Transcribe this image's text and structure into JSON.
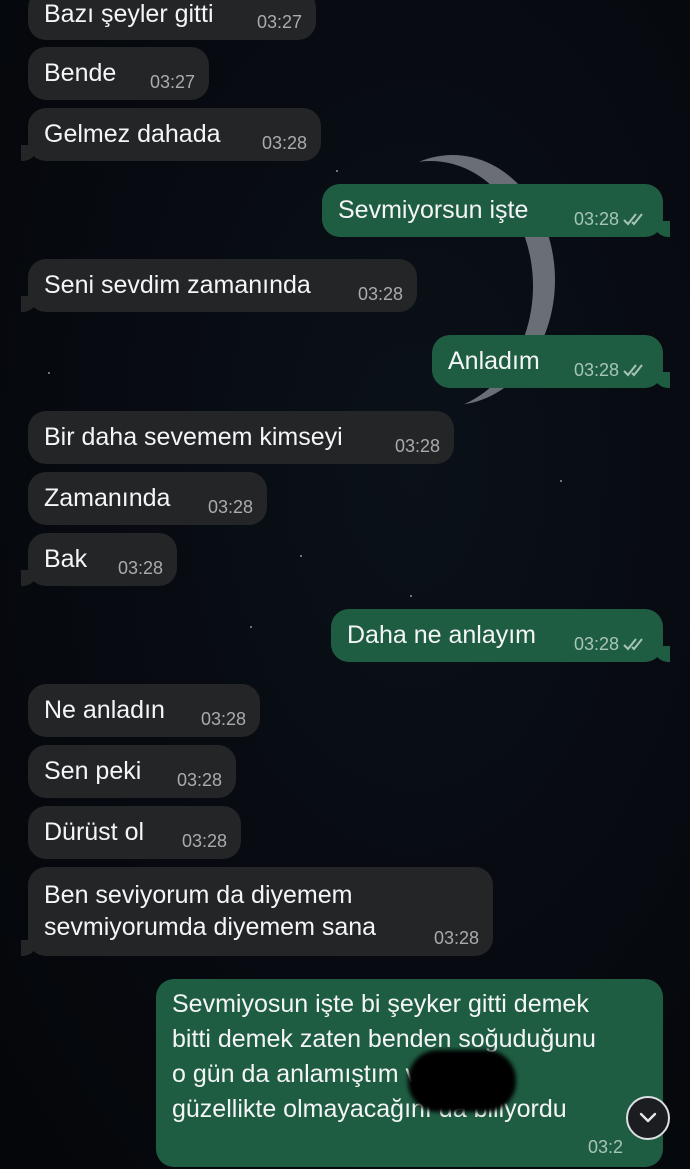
{
  "messages": [
    {
      "text": "Bazı şeyler gitti",
      "time": "03:27"
    },
    {
      "text": "Bende",
      "time": "03:27"
    },
    {
      "text": "Gelmez dahada",
      "time": "03:28"
    },
    {
      "text": "Sevmiyorsun işte",
      "time": "03:28"
    },
    {
      "text": "Seni sevdim zamanında",
      "time": "03:28"
    },
    {
      "text": "Anladım",
      "time": "03:28"
    },
    {
      "text": "Bir daha sevemem kimseyi",
      "time": "03:28"
    },
    {
      "text": "Zamanında",
      "time": "03:28"
    },
    {
      "text": "Bak",
      "time": "03:28"
    },
    {
      "text": "Daha ne anlayım",
      "time": "03:28"
    },
    {
      "text": "Ne anladın",
      "time": "03:28"
    },
    {
      "text": "Sen peki",
      "time": "03:28"
    },
    {
      "text": "Dürüst ol",
      "time": "03:28"
    },
    {
      "text": "Ben seviyorum da diyemem\nsevmiyorumda diyemem sana",
      "time": "03:28"
    },
    {
      "text": "Sevmiyosun işte bi şeyker gitti demek\nbitti demek zaten benden soğuduğunu\no gün da anlamıştım              ve zorla\ngüzellikte olmayacağını da biliyordu",
      "time": "03:2"
    }
  ],
  "colors": {
    "incoming_bubble": "#242526",
    "outgoing_bubble": "#1f5d43",
    "background": "#05080d"
  },
  "icons": {
    "read_receipt": "double-check-icon",
    "scroll_down": "chevron-down-icon"
  }
}
